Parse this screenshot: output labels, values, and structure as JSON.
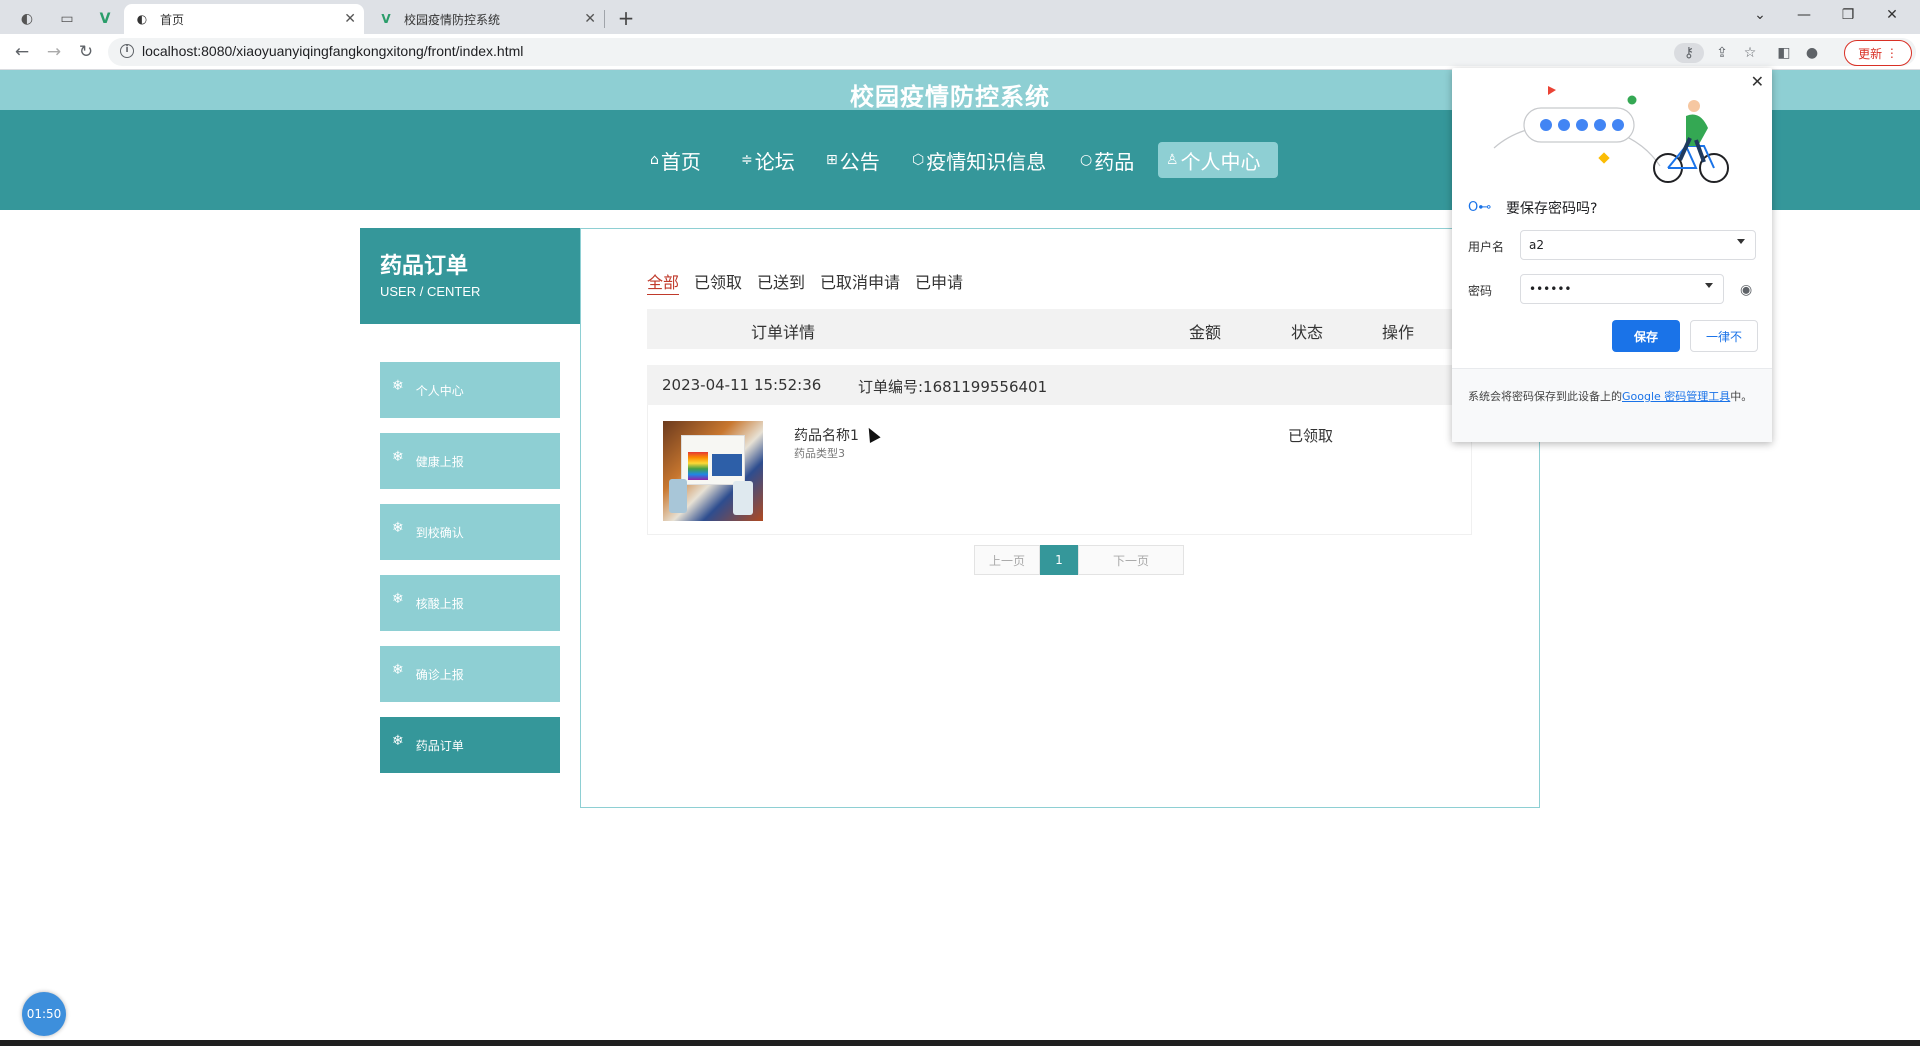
{
  "browser": {
    "tabs": [
      {
        "title": "首页",
        "active": true
      },
      {
        "title": "校园疫情防控系统",
        "active": false
      }
    ],
    "url": "localhost:8080/xiaoyuanyiqingfangkongxitong/front/index.html",
    "update_label": "更新"
  },
  "site": {
    "title": "校园疫情防控系统",
    "nav": [
      {
        "label": "首页",
        "icon": "home-icon"
      },
      {
        "label": "论坛",
        "icon": "forum-icon"
      },
      {
        "label": "公告",
        "icon": "notice-icon"
      },
      {
        "label": "疫情知识信息",
        "icon": "info-icon"
      },
      {
        "label": "药品",
        "icon": "medicine-icon"
      },
      {
        "label": "个人中心",
        "icon": "user-icon",
        "active": true
      }
    ]
  },
  "sidebar": {
    "title": "药品订单",
    "subtitle": "USER / CENTER",
    "items": [
      {
        "label": "个人中心"
      },
      {
        "label": "健康上报"
      },
      {
        "label": "到校确认"
      },
      {
        "label": "核酸上报"
      },
      {
        "label": "确诊上报"
      },
      {
        "label": "药品订单",
        "active": true
      }
    ]
  },
  "orders": {
    "filters": [
      "全部",
      "已领取",
      "已送到",
      "已取消申请",
      "已申请"
    ],
    "active_filter": "全部",
    "columns": [
      "订单详情",
      "金额",
      "状态",
      "操作"
    ],
    "list": [
      {
        "time": "2023-04-11 15:52:36",
        "order_no": "订单编号:1681199556401",
        "product_name": "药品名称1",
        "product_type": "药品类型3",
        "status": "已领取"
      }
    ],
    "pager": {
      "prev": "上一页",
      "current": "1",
      "next": "下一页"
    }
  },
  "password_popup": {
    "title": "要保存密码吗?",
    "username_label": "用户名",
    "username_value": "a2",
    "password_label": "密码",
    "password_value": "••••••",
    "save_label": "保存",
    "never_label": "一律不",
    "footer_text": "系统会将密码保存到此设备上的",
    "footer_link": "Google 密码管理工具",
    "footer_end": "中。"
  },
  "timer": "01:50"
}
